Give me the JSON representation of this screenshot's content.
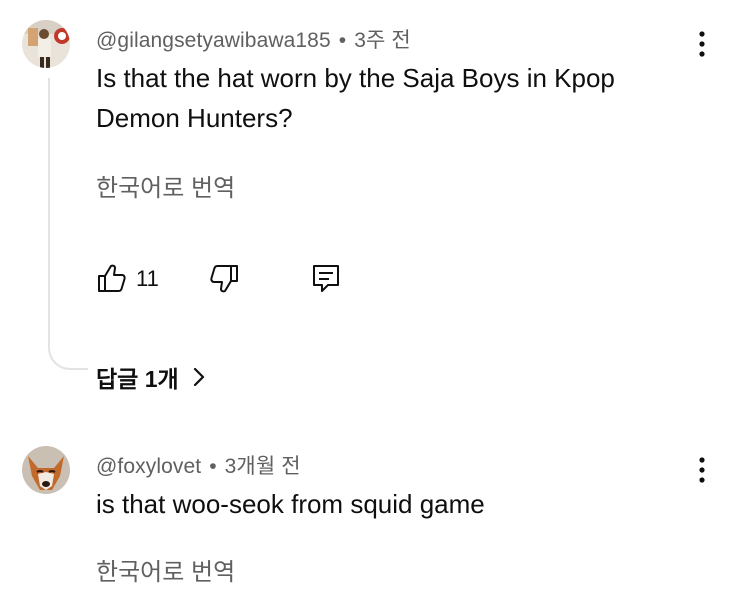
{
  "comments": [
    {
      "author": "@gilangsetyawibawa185",
      "time": "3주 전",
      "text_line1": "Is that the hat worn by the Saja Boys in Kpop",
      "text_line2": "Demon Hunters?",
      "translate": "한국어로 번역",
      "likes": "11",
      "replies_label": "답글 1개"
    },
    {
      "author": "@foxylovet",
      "time": "3개월 전",
      "text_line1": "is that woo-seok from squid game",
      "translate": "한국어로 번역"
    }
  ],
  "icons": {
    "menu": "more-vertical-icon",
    "like": "thumbs-up-icon",
    "dislike": "thumbs-down-icon",
    "reply": "comment-icon",
    "replies_chevron": "chevron-right-icon"
  },
  "colors": {
    "text": "#0f0f0f",
    "secondary": "#606060",
    "thread_line": "#e3e3e3"
  }
}
